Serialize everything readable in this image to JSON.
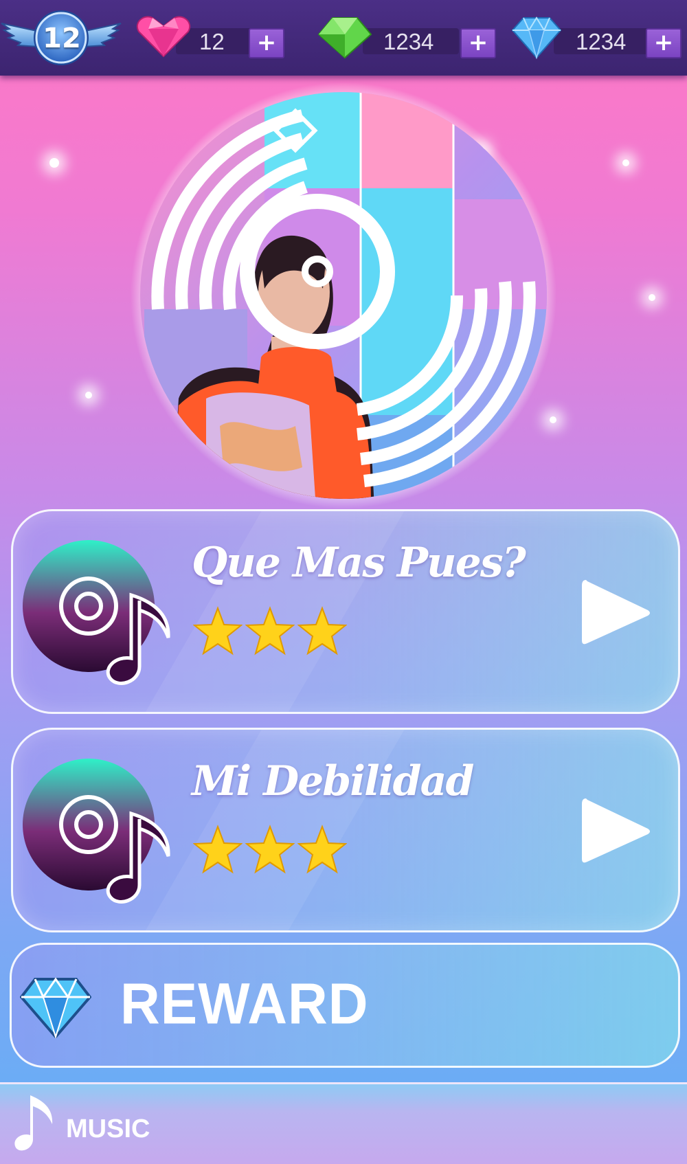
{
  "hud": {
    "level": "12",
    "lives": "12",
    "gems_green": "1234",
    "gems_blue": "1234",
    "plus_label": "+"
  },
  "songs": [
    {
      "title": "Que Mas Pues?",
      "stars": 3
    },
    {
      "title": "Mi Debilidad",
      "stars": 3
    }
  ],
  "reward": {
    "label": "REWARD"
  },
  "bottom_nav": {
    "music_label": "MUSIC"
  },
  "colors": {
    "topbar": "#3c2470",
    "plus_button": "#8a52cc",
    "star": "#ffd21a",
    "heart": "#ff4fa6",
    "gem_green": "#61d64a",
    "gem_blue": "#56b8f7"
  },
  "icons": {
    "level_badge": "winged-badge-icon",
    "lives": "heart-gem-icon",
    "gems_green": "green-gem-icon",
    "gems_blue": "blue-diamond-icon",
    "song": "music-disc-icon",
    "play": "play-icon",
    "reward": "diamond-icon",
    "music_tab": "music-note-icon"
  }
}
